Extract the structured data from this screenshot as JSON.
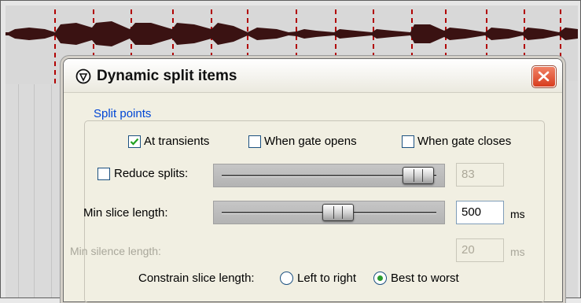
{
  "dialog": {
    "title": "Dynamic split items",
    "close_icon": "close-x-icon",
    "title_icon": "reaper-app-icon"
  },
  "split_points": {
    "legend": "Split points",
    "at_transients": {
      "label": "At transients",
      "checked": true
    },
    "when_gate_opens": {
      "label": "When gate opens",
      "checked": false
    },
    "when_gate_closes": {
      "label": "When gate closes",
      "checked": false
    },
    "reduce_splits": {
      "label": "Reduce splits:",
      "checked": false,
      "slider_level": 0.97,
      "value": "83"
    },
    "min_slice_length": {
      "label": "Min slice length:",
      "slider_level": 0.5,
      "value": "500",
      "unit": "ms"
    },
    "min_silence_length": {
      "label": "Min silence length:",
      "value": "20",
      "unit": "ms"
    },
    "constrain_slice_length": {
      "label": "Constrain slice length:",
      "options": [
        "Left to right",
        "Best to worst"
      ],
      "selected": "Best to worst"
    }
  },
  "colors": {
    "legend_blue": "#0046d5",
    "waveform": "#3a1212",
    "transient_marker": "#b10000",
    "close_button_red": "#d83d1e"
  }
}
